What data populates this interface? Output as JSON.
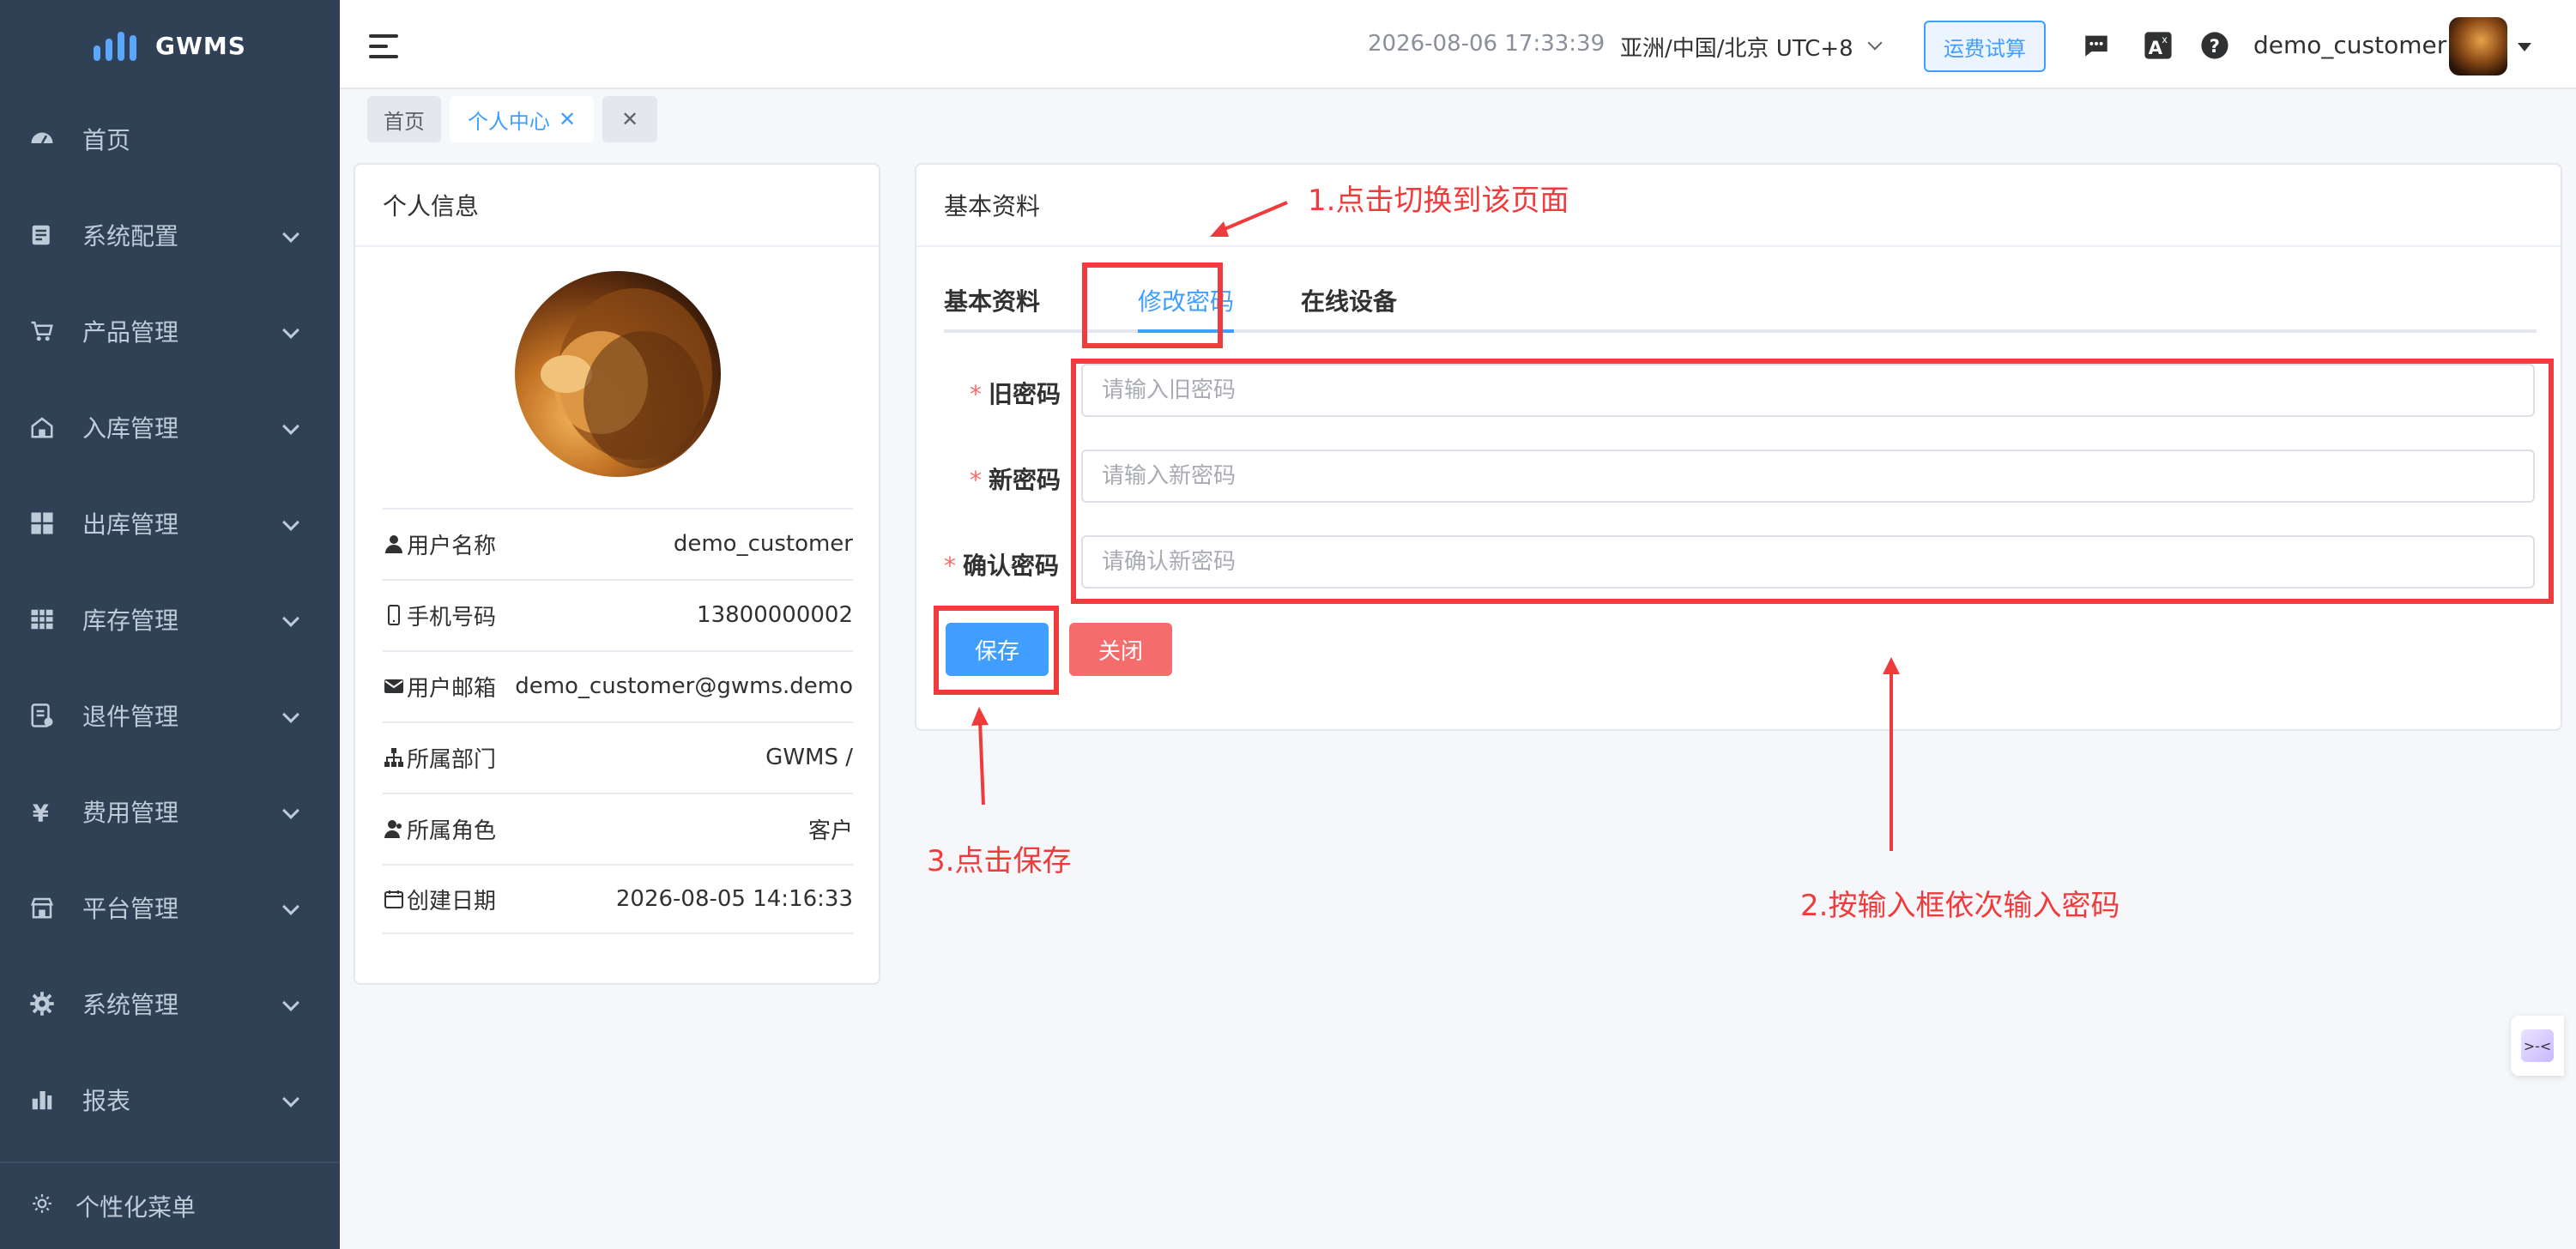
{
  "app": {
    "logo_text": "GWMS"
  },
  "sidebar": {
    "items": [
      {
        "label": "首页",
        "icon": "dashboard-icon",
        "has_children": false
      },
      {
        "label": "系统配置",
        "icon": "document-list-icon",
        "has_children": true
      },
      {
        "label": "产品管理",
        "icon": "shopping-cart-icon",
        "has_children": true
      },
      {
        "label": "入库管理",
        "icon": "warehouse-icon",
        "has_children": true
      },
      {
        "label": "出库管理",
        "icon": "grid-icon",
        "has_children": true
      },
      {
        "label": "库存管理",
        "icon": "table-icon",
        "has_children": true
      },
      {
        "label": "退件管理",
        "icon": "return-document-icon",
        "has_children": true
      },
      {
        "label": "费用管理",
        "icon": "yen-icon",
        "has_children": true
      },
      {
        "label": "平台管理",
        "icon": "shop-icon",
        "has_children": true
      },
      {
        "label": "系统管理",
        "icon": "gear-icon",
        "has_children": true
      },
      {
        "label": "报表",
        "icon": "bar-chart-icon",
        "has_children": true
      }
    ],
    "personal_menu_label": "个性化菜单"
  },
  "header": {
    "datetime": "2026-08-06 17:33:39",
    "timezone": "亚洲/中国/北京 UTC+8",
    "freight_button": "运费试算",
    "username": "demo_customer"
  },
  "tags": {
    "home": "首页",
    "active": "个人中心"
  },
  "profile": {
    "title": "个人信息",
    "rows": [
      {
        "icon": "user-icon",
        "label": "用户名称",
        "value": "demo_customer"
      },
      {
        "icon": "phone-icon",
        "label": "手机号码",
        "value": "13800000002"
      },
      {
        "icon": "mail-icon",
        "label": "用户邮箱",
        "value": "demo_customer@gwms.demo"
      },
      {
        "icon": "org-tree-icon",
        "label": "所属部门",
        "value": "GWMS /"
      },
      {
        "icon": "role-icon",
        "label": "所属角色",
        "value": "客户"
      },
      {
        "icon": "calendar-icon",
        "label": "创建日期",
        "value": "2026-08-05 14:16:33"
      }
    ]
  },
  "basic": {
    "title": "基本资料",
    "tabs": [
      "基本资料",
      "修改密码",
      "在线设备"
    ],
    "active_tab": "修改密码",
    "form": {
      "old_label": "旧密码",
      "old_placeholder": "请输入旧密码",
      "old_value": "",
      "new_label": "新密码",
      "new_placeholder": "请输入新密码",
      "new_value": "",
      "confirm_label": "确认密码",
      "confirm_placeholder": "请确认新密码",
      "confirm_value": ""
    },
    "save_label": "保存",
    "close_label": "关闭"
  },
  "annotations": {
    "step1": "1.点击切换到该页面",
    "step2": "2.按输入框依次输入密码",
    "step3": "3.点击保存"
  },
  "colors": {
    "primary": "#409eff",
    "danger": "#f56c6c",
    "sidebar_bg": "#304156",
    "annotation": "#ef3b3b"
  }
}
